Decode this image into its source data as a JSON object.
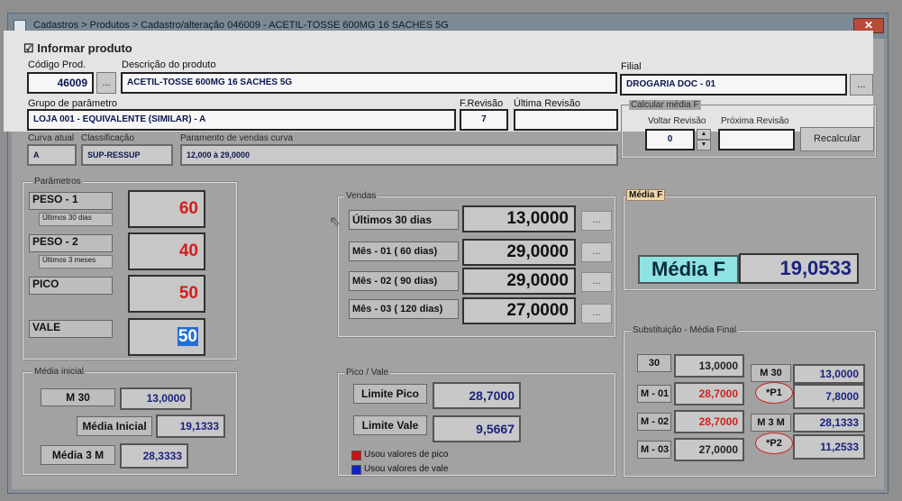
{
  "window": {
    "title": "Cadastros > Produtos > Cadastro/alteração  046009 - ACETIL-TOSSE 600MG 16 SACHES 5G",
    "close": "✕"
  },
  "inform": {
    "label": "Informar produto",
    "checked": "☑"
  },
  "product": {
    "code_label": "Código Prod.",
    "code": "46009",
    "code_btn": "...",
    "desc_label": "Descrição do  produto",
    "desc": "ACETIL-TOSSE 600MG 16 SACHES 5G",
    "filial_label": "Filial",
    "filial": "DROGARIA DOC - 01",
    "filial_btn": "...",
    "grupo_label": "Grupo de parâmetro",
    "grupo": "LOJA 001 - EQUIVALENTE (SIMILAR) - A",
    "frev_label": "F.Revisão",
    "frev": "7",
    "ultima_label": "Última Revisão",
    "ultima": "",
    "curva_label": "Curva atual",
    "curva": "A",
    "classif_label": "Classificação",
    "classif": "SUP-RESSUP",
    "param_label": "Paramento de vendas curva",
    "param": "12,000  à  29,0000"
  },
  "calc": {
    "title": "Calcular média F",
    "voltar_label": "Voltar Revisão",
    "voltar": "0",
    "proxima_label": "Próxima Revisão",
    "proxima": "",
    "recalc": "Recalcular"
  },
  "parametros": {
    "title": "Parâmetros",
    "items": [
      {
        "label": "PESO - 1",
        "sub": "Últimos 30 dias",
        "value": "60"
      },
      {
        "label": "PESO - 2",
        "sub": "Últimos 3 meses",
        "value": "40"
      },
      {
        "label": "PICO",
        "sub": "",
        "value": "50"
      },
      {
        "label": "VALE",
        "sub": "",
        "value": "50"
      }
    ]
  },
  "vendas": {
    "title": "Vendas",
    "rows": [
      {
        "label": "Últimos 30 dias",
        "value": "13,0000",
        "btn": "..."
      },
      {
        "label": "Mês - 01 ( 60 dias)",
        "value": "29,0000",
        "btn": "..."
      },
      {
        "label": "Mês - 02 ( 90 dias)",
        "value": "29,0000",
        "btn": "..."
      },
      {
        "label": "Mês - 03 ( 120 dias)",
        "value": "27,0000",
        "btn": "..."
      }
    ]
  },
  "media_f": {
    "header": "Média F",
    "label": "Média F",
    "value": "19,0533"
  },
  "media_inicial": {
    "title": "Média inicial",
    "m30_label": "M 30",
    "m30": "13,0000",
    "mi_label": "Média Inicial",
    "mi": "19,1333",
    "m3m_label": "Média 3 M",
    "m3m": "28,3333"
  },
  "pico_vale": {
    "title": "Pico / Vale",
    "pico_label": "Limite Pico",
    "pico": "28,7000",
    "vale_label": "Limite Vale",
    "vale": "9,5667",
    "legend_pico": "Usou valores de pico",
    "legend_vale": "Usou valores de vale",
    "color_pico": "#cc1111",
    "color_vale": "#1122cc"
  },
  "subst": {
    "title": "Substituição - Média Final",
    "left": [
      {
        "label": "30",
        "value": "13,0000"
      },
      {
        "label": "M - 01",
        "value": "28,7000"
      },
      {
        "label": "M - 02",
        "value": "28,7000"
      },
      {
        "label": "M - 03",
        "value": "27,0000"
      }
    ],
    "right": [
      {
        "label": "M 30",
        "value": "13,0000"
      },
      {
        "label": "*P1",
        "value": "7,8000"
      },
      {
        "label": "M 3 M",
        "value": "28,1333"
      },
      {
        "label": "*P2",
        "value": "11,2533"
      }
    ]
  }
}
